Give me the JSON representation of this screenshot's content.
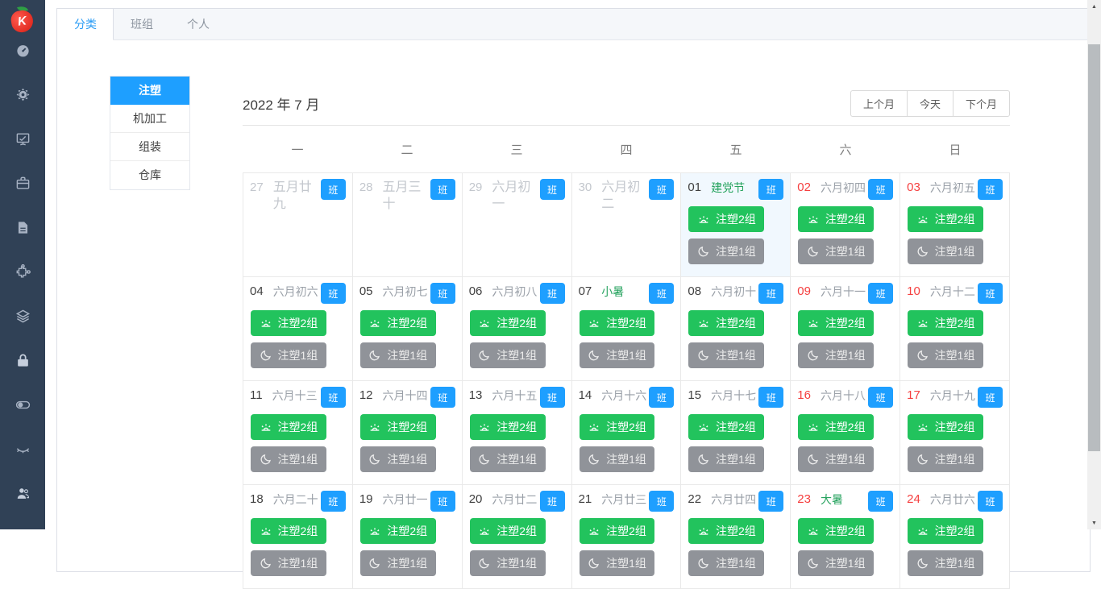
{
  "app": {
    "logo_letter": "K"
  },
  "sidebar": {
    "icons": [
      "dashboard-icon",
      "gear-icon",
      "chart-board-icon",
      "briefcase-icon",
      "document-icon",
      "puzzle-icon",
      "layers-icon",
      "lock-icon",
      "toggle-icon",
      "eye-closed-icon",
      "users-icon"
    ]
  },
  "tabs": [
    {
      "label": "分类",
      "active": true
    },
    {
      "label": "班组",
      "active": false
    },
    {
      "label": "个人",
      "active": false
    }
  ],
  "categories": [
    {
      "label": "注塑",
      "active": true
    },
    {
      "label": "机加工",
      "active": false
    },
    {
      "label": "组装",
      "active": false
    },
    {
      "label": "仓库",
      "active": false
    }
  ],
  "calendar": {
    "title": "2022 年 7 月",
    "nav": {
      "prev": "上个月",
      "today": "今天",
      "next": "下个月"
    },
    "weekdays": [
      "一",
      "二",
      "三",
      "四",
      "五",
      "六",
      "日"
    ],
    "badge_label": "班",
    "day_shift_label": "注塑2组",
    "night_shift_label": "注塑1组",
    "days": [
      {
        "num": "27",
        "lunar": "五月廿九",
        "other": true,
        "red": false,
        "festival": false,
        "highlight": false,
        "shifts": false
      },
      {
        "num": "28",
        "lunar": "五月三十",
        "other": true,
        "red": false,
        "festival": false,
        "highlight": false,
        "shifts": false
      },
      {
        "num": "29",
        "lunar": "六月初一",
        "other": true,
        "red": false,
        "festival": false,
        "highlight": false,
        "shifts": false
      },
      {
        "num": "30",
        "lunar": "六月初二",
        "other": true,
        "red": false,
        "festival": false,
        "highlight": false,
        "shifts": false
      },
      {
        "num": "01",
        "lunar": "建党节",
        "other": false,
        "red": false,
        "festival": true,
        "highlight": true,
        "shifts": true
      },
      {
        "num": "02",
        "lunar": "六月初四",
        "other": false,
        "red": true,
        "festival": false,
        "highlight": false,
        "shifts": true
      },
      {
        "num": "03",
        "lunar": "六月初五",
        "other": false,
        "red": true,
        "festival": false,
        "highlight": false,
        "shifts": true
      },
      {
        "num": "04",
        "lunar": "六月初六",
        "other": false,
        "red": false,
        "festival": false,
        "highlight": false,
        "shifts": true
      },
      {
        "num": "05",
        "lunar": "六月初七",
        "other": false,
        "red": false,
        "festival": false,
        "highlight": false,
        "shifts": true
      },
      {
        "num": "06",
        "lunar": "六月初八",
        "other": false,
        "red": false,
        "festival": false,
        "highlight": false,
        "shifts": true
      },
      {
        "num": "07",
        "lunar": "小暑",
        "other": false,
        "red": false,
        "festival": true,
        "highlight": false,
        "shifts": true
      },
      {
        "num": "08",
        "lunar": "六月初十",
        "other": false,
        "red": false,
        "festival": false,
        "highlight": false,
        "shifts": true
      },
      {
        "num": "09",
        "lunar": "六月十一",
        "other": false,
        "red": true,
        "festival": false,
        "highlight": false,
        "shifts": true
      },
      {
        "num": "10",
        "lunar": "六月十二",
        "other": false,
        "red": true,
        "festival": false,
        "highlight": false,
        "shifts": true
      },
      {
        "num": "11",
        "lunar": "六月十三",
        "other": false,
        "red": false,
        "festival": false,
        "highlight": false,
        "shifts": true
      },
      {
        "num": "12",
        "lunar": "六月十四",
        "other": false,
        "red": false,
        "festival": false,
        "highlight": false,
        "shifts": true
      },
      {
        "num": "13",
        "lunar": "六月十五",
        "other": false,
        "red": false,
        "festival": false,
        "highlight": false,
        "shifts": true
      },
      {
        "num": "14",
        "lunar": "六月十六",
        "other": false,
        "red": false,
        "festival": false,
        "highlight": false,
        "shifts": true
      },
      {
        "num": "15",
        "lunar": "六月十七",
        "other": false,
        "red": false,
        "festival": false,
        "highlight": false,
        "shifts": true
      },
      {
        "num": "16",
        "lunar": "六月十八",
        "other": false,
        "red": true,
        "festival": false,
        "highlight": false,
        "shifts": true
      },
      {
        "num": "17",
        "lunar": "六月十九",
        "other": false,
        "red": true,
        "festival": false,
        "highlight": false,
        "shifts": true
      },
      {
        "num": "18",
        "lunar": "六月二十",
        "other": false,
        "red": false,
        "festival": false,
        "highlight": false,
        "shifts": true
      },
      {
        "num": "19",
        "lunar": "六月廿一",
        "other": false,
        "red": false,
        "festival": false,
        "highlight": false,
        "shifts": true
      },
      {
        "num": "20",
        "lunar": "六月廿二",
        "other": false,
        "red": false,
        "festival": false,
        "highlight": false,
        "shifts": true
      },
      {
        "num": "21",
        "lunar": "六月廿三",
        "other": false,
        "red": false,
        "festival": false,
        "highlight": false,
        "shifts": true
      },
      {
        "num": "22",
        "lunar": "六月廿四",
        "other": false,
        "red": false,
        "festival": false,
        "highlight": false,
        "shifts": true
      },
      {
        "num": "23",
        "lunar": "大暑",
        "other": false,
        "red": true,
        "festival": true,
        "highlight": false,
        "shifts": true
      },
      {
        "num": "24",
        "lunar": "六月廿六",
        "other": false,
        "red": true,
        "festival": false,
        "highlight": false,
        "shifts": true
      }
    ]
  },
  "colors": {
    "sidebar_bg": "#304156",
    "accent_blue": "#1e9fff",
    "day_shift_green": "#22c35d",
    "night_shift_gray": "#909399",
    "festival_green": "#27a35f",
    "weekend_red": "#f53f3f"
  }
}
